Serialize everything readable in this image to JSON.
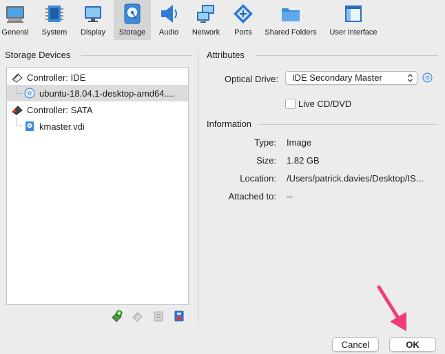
{
  "toolbar": {
    "tabs": [
      {
        "label": "General",
        "icon": "monitor-icon"
      },
      {
        "label": "System",
        "icon": "chip-icon"
      },
      {
        "label": "Display",
        "icon": "display-icon"
      },
      {
        "label": "Storage",
        "icon": "hard-disk-icon",
        "selected": true
      },
      {
        "label": "Audio",
        "icon": "speaker-icon"
      },
      {
        "label": "Network",
        "icon": "network-icon"
      },
      {
        "label": "Ports",
        "icon": "ports-icon"
      },
      {
        "label": "Shared Folders",
        "icon": "folder-icon"
      },
      {
        "label": "User Interface",
        "icon": "window-icon"
      }
    ]
  },
  "storage": {
    "title": "Storage Devices",
    "tree": [
      {
        "label": "Controller: IDE",
        "icon": "ide-controller-icon"
      },
      {
        "label": "ubuntu-18.04.1-desktop-amd64....",
        "icon": "optical-disc-icon",
        "selected": true
      },
      {
        "label": "Controller: SATA",
        "icon": "sata-controller-icon"
      },
      {
        "label": "kmaster.vdi",
        "icon": "hard-disk-file-icon"
      }
    ],
    "tools": [
      "add-attachment-icon",
      "remove-attachment-icon",
      "add-controller-icon",
      "remove-controller-icon"
    ]
  },
  "attributes": {
    "title": "Attributes",
    "optical_drive_label": "Optical Drive:",
    "optical_drive_value": "IDE Secondary Master",
    "live_cd_label": "Live CD/DVD",
    "live_cd_checked": false
  },
  "information": {
    "title": "Information",
    "type_label": "Type:",
    "type_value": "Image",
    "size_label": "Size:",
    "size_value": "1.82 GB",
    "location_label": "Location:",
    "location_value": "/Users/patrick.davies/Desktop/IS...",
    "attached_label": "Attached to:",
    "attached_value": "--"
  },
  "buttons": {
    "cancel": "Cancel",
    "ok": "OK"
  },
  "colors": {
    "selected_tab": "#d5d5d5",
    "selected_row": "#dcdcdc",
    "accent_blue": "#2f7ad8",
    "arrow_pink": "#f03d7a"
  }
}
